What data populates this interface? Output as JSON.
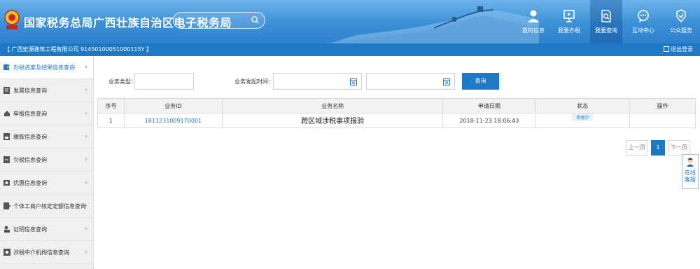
{
  "header": {
    "title": "国家税务总局广西壮族自治区电子税务局",
    "search_placeholder": "",
    "nav": [
      {
        "label": "我的信息",
        "icon": "user-icon",
        "active": false
      },
      {
        "label": "我要办税",
        "icon": "monitor-icon",
        "active": false
      },
      {
        "label": "我要查询",
        "icon": "document-search-icon",
        "active": true
      },
      {
        "label": "互动中心",
        "icon": "chat-icon",
        "active": false
      },
      {
        "label": "公众服务",
        "icon": "service-icon",
        "active": false
      }
    ]
  },
  "company_bar": {
    "company": "【 广西宏源建筑工程有限公司   91450100051000115Y 】",
    "logout": "退出登录"
  },
  "sidebar": {
    "items": [
      {
        "label": "办税进度及结果信息查询",
        "icon": "progress-icon",
        "active": true
      },
      {
        "label": "发票信息查询",
        "icon": "invoice-icon",
        "active": false
      },
      {
        "label": "申报信息查询",
        "icon": "declare-icon",
        "active": false
      },
      {
        "label": "缴款信息查询",
        "icon": "payment-icon",
        "active": false
      },
      {
        "label": "欠税信息查询",
        "icon": "arrears-icon",
        "active": false
      },
      {
        "label": "优惠信息查询",
        "icon": "discount-icon",
        "active": false
      },
      {
        "label": "个体工商户核定定额信息查询",
        "icon": "quota-icon",
        "active": false
      },
      {
        "label": "证明信息查询",
        "icon": "certificate-icon",
        "active": false
      },
      {
        "label": "涉税中介机构信息查询",
        "icon": "agency-icon",
        "active": false
      }
    ]
  },
  "filters": {
    "type_label": "业务类型：",
    "type_value": "",
    "time_label": "业务发起时间：",
    "start_value": "",
    "end_value": "",
    "query_label": "查询"
  },
  "table": {
    "headers": [
      "序号",
      "业务ID",
      "业务名称",
      "申请日期",
      "状态",
      "操作"
    ],
    "rows": [
      {
        "index": "1",
        "id": "1811231009170001",
        "name": "跨区域涉税事项报验",
        "date": "2018-11-23 18:06:43",
        "status": "受理中",
        "action": ""
      }
    ]
  },
  "pager": {
    "prev": "上一页",
    "current": "1",
    "next": "下一页"
  },
  "online_service": {
    "line1": "在线",
    "line2": "客服"
  },
  "colors": {
    "primary": "#1f78c4",
    "header_gradient_top": "#6db4ea",
    "sidebar_bg": "#f0f0f0"
  }
}
